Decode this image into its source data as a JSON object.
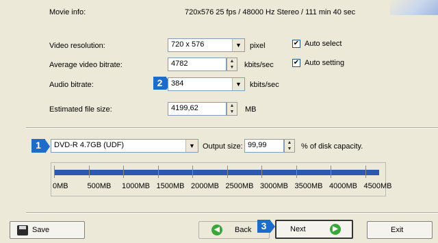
{
  "movie_info": {
    "label": "Movie info:",
    "value": "720x576 25 fps / 48000 Hz Stereo / 111 min 40 sec"
  },
  "video_resolution": {
    "label": "Video resolution:",
    "value": "720 x 576",
    "unit": "pixel",
    "checkbox_label": "Auto select",
    "checked": true
  },
  "average_video_bitrate": {
    "label": "Average video bitrate:",
    "value": "4782",
    "unit": "kbits/sec",
    "checkbox_label": "Auto setting",
    "checked": true
  },
  "audio_bitrate": {
    "label": "Audio bitrate:",
    "value": "384",
    "unit": "kbits/sec",
    "badge": "2"
  },
  "estimated_file_size": {
    "label": "Estimated file size:",
    "value": "4199,62",
    "unit": "MB"
  },
  "disc": {
    "badge": "1",
    "selected": "DVD-R 4.7GB (UDF)",
    "output_size_label": "Output size:",
    "output_size_value": "99,99",
    "output_size_unit": "% of disk capacity."
  },
  "usage_bar": {
    "fill_fraction": 0.9999,
    "scale_labels": [
      "0MB",
      "500MB",
      "1000MB",
      "1500MB",
      "2000MB",
      "2500MB",
      "3000MB",
      "3500MB",
      "4000MB",
      "4500MB"
    ]
  },
  "buttons": {
    "save": "Save",
    "back": "Back",
    "next": "Next",
    "next_badge": "3",
    "exit": "Exit"
  },
  "colors": {
    "badge_blue": "#1d6cc9",
    "bar_blue": "#2c58b0",
    "back_icon": "#3aa63a",
    "next_icon": "#3aa63a"
  },
  "icons": {
    "save": "floppy-disk-icon",
    "back": "back-arrow-icon",
    "next": "next-arrow-icon"
  }
}
